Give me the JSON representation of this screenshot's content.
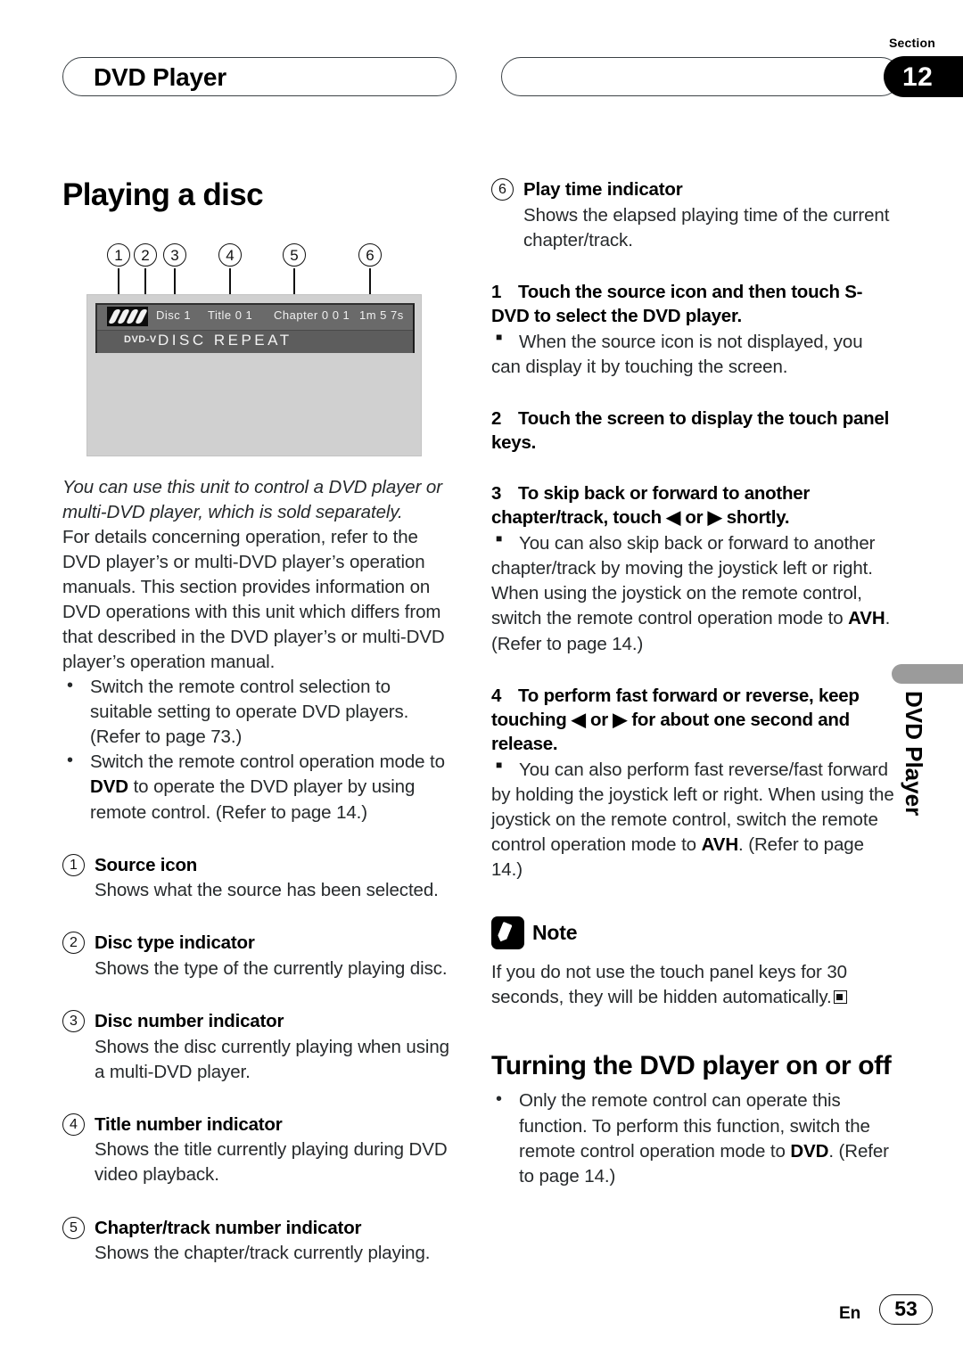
{
  "header": {
    "left_pill_title": "DVD Player",
    "right_pill_title": "",
    "section_word": "Section",
    "section_number": "12"
  },
  "side_tab": {
    "label": "DVD Player"
  },
  "footer": {
    "language": "En",
    "page_number": "53"
  },
  "left_column": {
    "title": "Playing a disc",
    "figure": {
      "callout_numbers": [
        "1",
        "2",
        "3",
        "4",
        "5",
        "6"
      ],
      "lcd": {
        "source_icon": "disc-stack-icon",
        "disc_label": "Disc 1",
        "title_label": "Title 0 1",
        "chapter_label": "Chapter 0 0 1",
        "time_label": "1m 5 7s",
        "disc_type": "DVD-V",
        "repeat_text": "DISC  REPEAT"
      }
    },
    "intro_italic": "You can use this unit to control a DVD player or multi-DVD player, which is sold separately.",
    "intro_body": "For details concerning operation, refer to the DVD player’s or multi-DVD player’s operation manuals. This section provides information on DVD operations with this unit which differs from that described in the DVD player’s or multi-DVD player’s operation manual.",
    "bullets": [
      "Switch the remote control selection to suitable setting to operate DVD players. (Refer to page 73.)",
      "Switch the remote control operation mode to DVD to operate the DVD player by using remote control. (Refer to page 14.)"
    ],
    "bullet2_parts": {
      "pre": "Switch the remote control operation mode to ",
      "bold": "DVD",
      "post": " to operate the DVD player by using remote control. (Refer to page 14.)"
    },
    "items": [
      {
        "num": "1",
        "label": "Source icon",
        "desc": "Shows what the source has been selected."
      },
      {
        "num": "2",
        "label": "Disc type indicator",
        "desc": "Shows the type of the currently playing disc."
      },
      {
        "num": "3",
        "label": "Disc number indicator",
        "desc": "Shows the disc currently playing when using a multi-DVD player."
      },
      {
        "num": "4",
        "label": "Title number indicator",
        "desc": "Shows the title currently playing during DVD video playback."
      },
      {
        "num": "5",
        "label": "Chapter/track number indicator",
        "desc": "Shows the chapter/track currently playing."
      }
    ]
  },
  "right_column": {
    "item6": {
      "num": "6",
      "label": "Play time indicator",
      "desc": "Shows the elapsed playing time of the current chapter/track."
    },
    "steps": [
      {
        "num": "1",
        "text": "Touch the source icon and then touch S-DVD to select the DVD player.",
        "note_lead": "When the source icon is not displayed, you",
        "note_cont": "can display it by touching the screen."
      },
      {
        "num": "2",
        "text": "Touch the screen to display the touch panel keys."
      },
      {
        "num": "3",
        "text": "To skip back or forward to another chapter/track, touch ◀ or ▶ shortly.",
        "note_lead": "You can also skip back or forward to another",
        "note_cont": "chapter/track by moving the joystick left or right. When using the joystick on the remote control, switch the remote control operation mode to ",
        "note_bold": "AVH",
        "note_tail": ". (Refer to page 14.)"
      },
      {
        "num": "4",
        "text": "To perform fast forward or reverse, keep touching ◀ or ▶ for about one second and release.",
        "note_lead": "You can also perform fast reverse/fast forward",
        "note_cont": "by holding the joystick left or right. When using the joystick on the remote control, switch the remote control operation mode to ",
        "note_bold": "AVH",
        "note_tail": ". (Refer to page 14.)"
      }
    ],
    "note": {
      "icon": "pencil-icon",
      "title": "Note",
      "body": "If you do not use the touch panel keys for 30 seconds, they will be hidden automatically."
    },
    "subtitle": "Turning the DVD player on or off",
    "subtitle_bullet": {
      "pre": "Only the remote control can operate this function. To perform this function, switch the remote control operation mode to ",
      "bold": "DVD",
      "post": ". (Refer to page 14.)"
    }
  }
}
